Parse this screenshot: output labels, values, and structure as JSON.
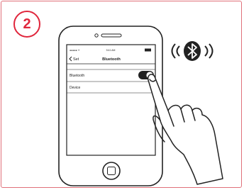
{
  "step": {
    "number": "2"
  },
  "phone": {
    "status_bar": {
      "carrier": "●●●●● ᯤ",
      "time": "9:41 AM",
      "battery": "▭"
    },
    "nav": {
      "back_label": "Set",
      "title": "Bluetooth"
    },
    "rows": [
      {
        "label": "Bluetooth",
        "toggle_on": true
      },
      {
        "label": "Device"
      }
    ]
  },
  "colors": {
    "accent": "#e0263c",
    "line": "#222222"
  },
  "icons": [
    "bluetooth-icon",
    "signal-waves-icon",
    "pointing-hand-icon",
    "home-button-icon"
  ]
}
